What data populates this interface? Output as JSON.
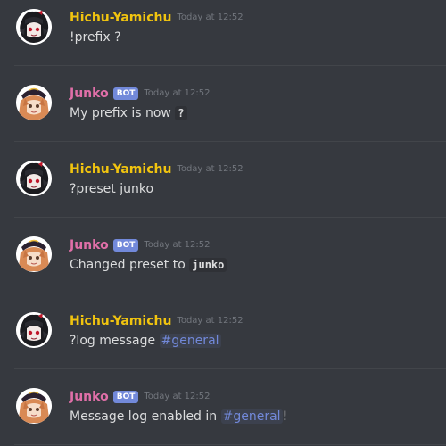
{
  "colors": {
    "background": "#36393f",
    "hichu_name": "#f1c40f",
    "junko_name": "#e06fa8",
    "bot_badge": "#7289da",
    "mention": "#7289da",
    "timestamp": "#72767d",
    "text": "#dcddde"
  },
  "messages": [
    {
      "username": "Hichu-Yamichu",
      "timestamp": "Today at 12:52",
      "content": "!prefix ?"
    },
    {
      "username": "Junko",
      "badge": "BOT",
      "timestamp": "Today at 12:52",
      "content_text": "My prefix is now ",
      "content_code": "?"
    },
    {
      "username": "Hichu-Yamichu",
      "timestamp": "Today at 12:52",
      "content": "?preset junko"
    },
    {
      "username": "Junko",
      "badge": "BOT",
      "timestamp": "Today at 12:52",
      "content_text": "Changed preset to ",
      "content_code": "junko"
    },
    {
      "username": "Hichu-Yamichu",
      "timestamp": "Today at 12:52",
      "content_text": "?log message ",
      "mention": "#general"
    },
    {
      "username": "Junko",
      "badge": "BOT",
      "timestamp": "Today at 12:52",
      "content_text": "Message log enabled in ",
      "mention": "#general",
      "content_after": "!"
    }
  ]
}
